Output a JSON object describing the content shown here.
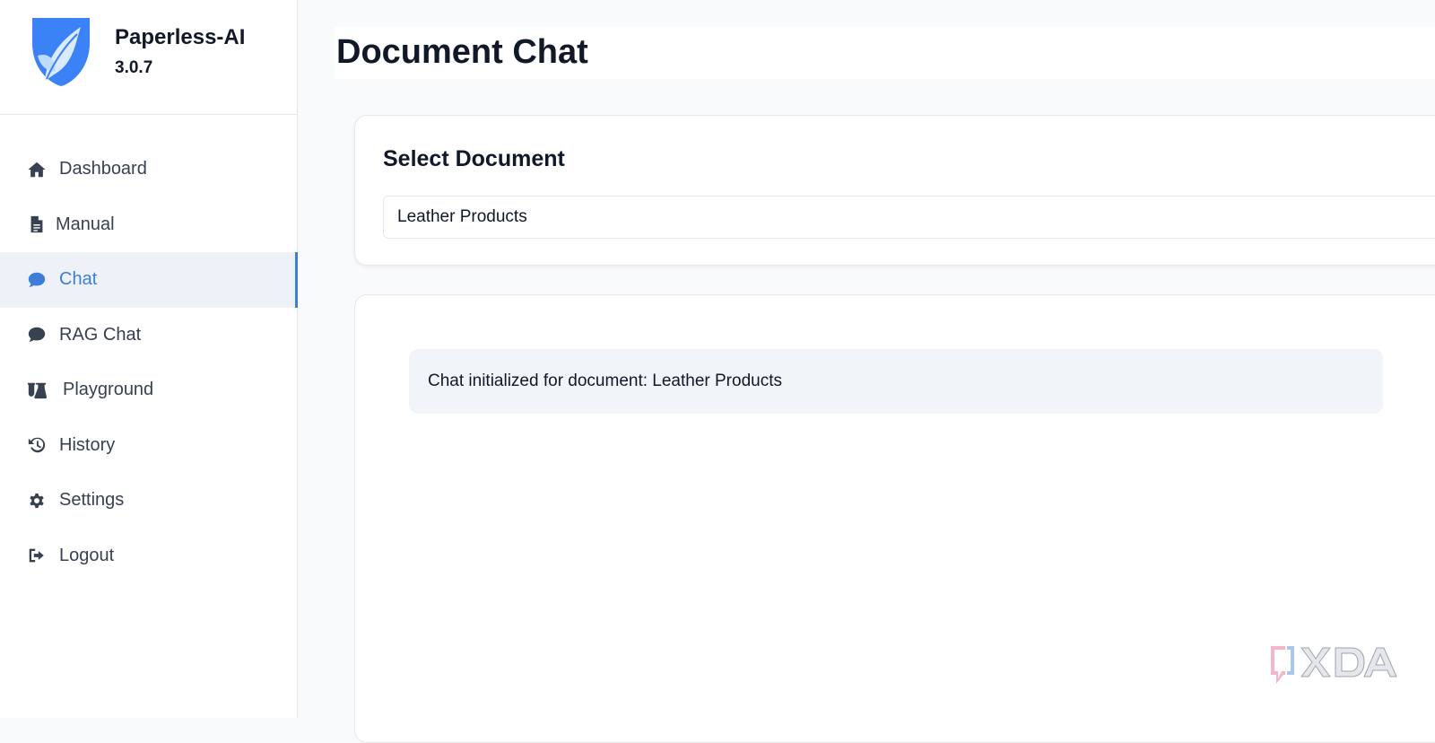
{
  "app": {
    "name": "Paperless-AI",
    "version": "3.0.7"
  },
  "sidebar": {
    "items": [
      {
        "label": "Dashboard",
        "icon": "home-icon",
        "active": false
      },
      {
        "label": "Manual",
        "icon": "file-icon",
        "active": false
      },
      {
        "label": "Chat",
        "icon": "chat-bubble-icon",
        "active": true
      },
      {
        "label": "RAG Chat",
        "icon": "chat-bubble-icon",
        "active": false
      },
      {
        "label": "Playground",
        "icon": "flask-icon",
        "active": false
      },
      {
        "label": "History",
        "icon": "history-icon",
        "active": false
      },
      {
        "label": "Settings",
        "icon": "gear-icon",
        "active": false
      },
      {
        "label": "Logout",
        "icon": "logout-icon",
        "active": false
      }
    ]
  },
  "header": {
    "title": "Document Chat"
  },
  "document_select": {
    "title": "Select Document",
    "selected_value": "Leather Products"
  },
  "chat": {
    "messages": [
      {
        "text": "Chat initialized for document: Leather Products"
      }
    ]
  },
  "watermark": {
    "text": "XDA"
  },
  "colors": {
    "accent": "#3b7dd8",
    "active_bg": "#eef2f8",
    "message_bg": "#f1f4f8"
  }
}
